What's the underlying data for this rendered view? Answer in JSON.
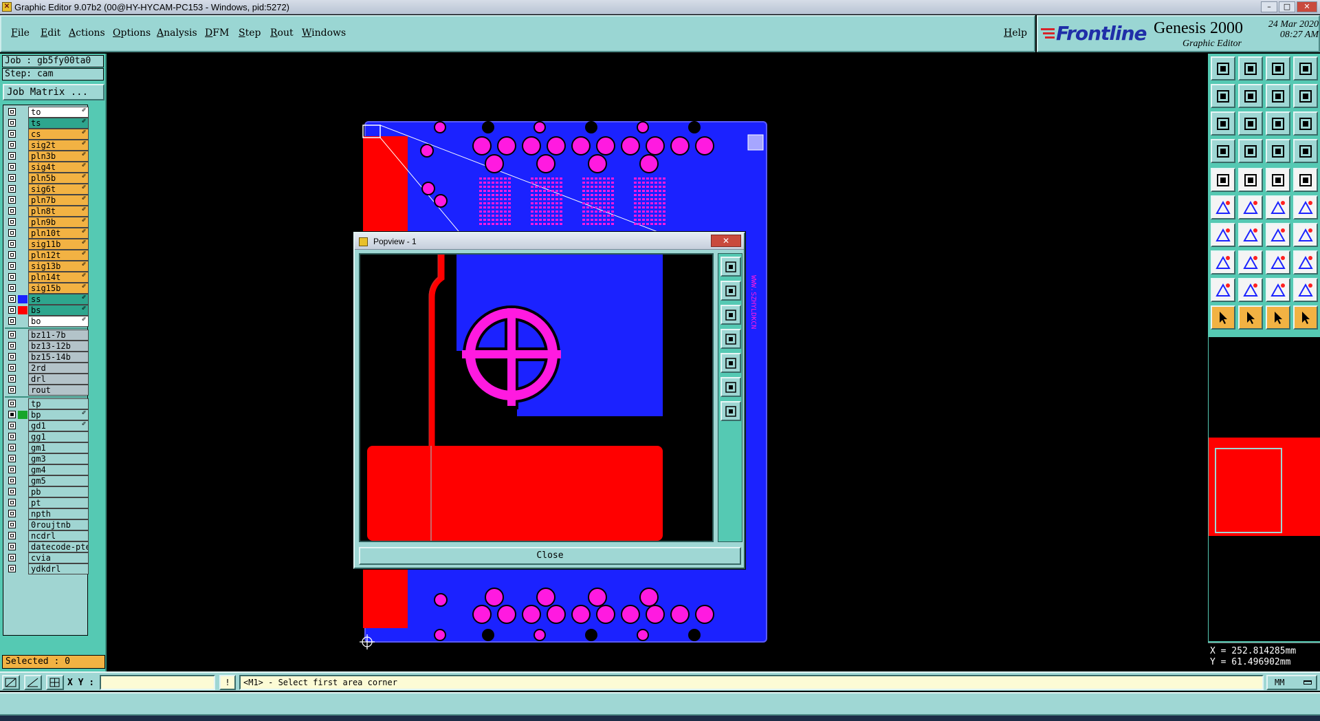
{
  "window": {
    "title": "Graphic Editor 9.07b2 (00@HY-HYCAM-PC153 - Windows, pid:5272)"
  },
  "menu": {
    "items": [
      "File",
      "Edit",
      "Actions",
      "Options",
      "Analysis",
      "DFM",
      "Step",
      "Rout",
      "Windows"
    ],
    "help": "Help"
  },
  "brand": {
    "logo": "Frontline",
    "product": "Genesis 2000",
    "subtitle": "Graphic Editor",
    "date": "24 Mar 2020",
    "time": "08:27 AM"
  },
  "job": {
    "job_line": "Job : gb5fy00ta0",
    "step_line": "Step: cam",
    "matrix_button": "Job Matrix ..."
  },
  "layers": {
    "board": [
      {
        "name": "to",
        "color": "#ffffff"
      },
      {
        "name": "ts",
        "color": "#2ea68e"
      },
      {
        "name": "cs",
        "color": "#f2b243"
      },
      {
        "name": "sig2t",
        "color": "#f2b243"
      },
      {
        "name": "pln3b",
        "color": "#f2b243"
      },
      {
        "name": "sig4t",
        "color": "#f2b243"
      },
      {
        "name": "pln5b",
        "color": "#f2b243"
      },
      {
        "name": "sig6t",
        "color": "#f2b243"
      },
      {
        "name": "pln7b",
        "color": "#f2b243"
      },
      {
        "name": "pln8t",
        "color": "#f2b243"
      },
      {
        "name": "pln9b",
        "color": "#f2b243"
      },
      {
        "name": "pln10t",
        "color": "#f2b243"
      },
      {
        "name": "sig11b",
        "color": "#f2b243"
      },
      {
        "name": "pln12t",
        "color": "#f2b243"
      },
      {
        "name": "sig13b",
        "color": "#f2b243"
      },
      {
        "name": "pln14t",
        "color": "#f2b243"
      },
      {
        "name": "sig15b",
        "color": "#f2b243"
      },
      {
        "name": "ss",
        "color": "#2ea68e",
        "swatch": "#1b22ff"
      },
      {
        "name": "bs",
        "color": "#2ea68e",
        "swatch": "#ff0000"
      },
      {
        "name": "bo",
        "color": "#ffffff"
      }
    ],
    "drill": [
      {
        "name": "bz11-7b"
      },
      {
        "name": "bz13-12b"
      },
      {
        "name": "bz15-14b"
      },
      {
        "name": "2rd"
      },
      {
        "name": "drl"
      },
      {
        "name": "rout"
      }
    ],
    "misc": [
      {
        "name": "tp"
      },
      {
        "name": "bp",
        "swatch": "#17a52a",
        "checked": true
      },
      {
        "name": "gd1"
      },
      {
        "name": "gg1"
      },
      {
        "name": "gm1"
      },
      {
        "name": "gm3"
      },
      {
        "name": "gm4"
      },
      {
        "name": "gm5"
      },
      {
        "name": "pb"
      },
      {
        "name": "pt"
      },
      {
        "name": "npth"
      },
      {
        "name": "0roujtnb"
      },
      {
        "name": "ncdrl"
      },
      {
        "name": "datecode-pte"
      },
      {
        "name": "cvia"
      },
      {
        "name": "ydkdrl"
      }
    ],
    "edit_glyph": "✐"
  },
  "status": {
    "selected": "Selected : 0"
  },
  "popview": {
    "title": "Popview - 1",
    "close_x": "✕",
    "close_button": "Close"
  },
  "coords": {
    "x": "X = 252.814285mm",
    "y": "Y = 61.496902mm"
  },
  "command": {
    "xy_label": "X Y :",
    "xy_value": "",
    "info_label": "!",
    "prompt": "<M1> - Select first area corner",
    "units": "MM"
  },
  "board": {
    "side_text": "WWW.SZHYLDKCN"
  },
  "colors": {
    "panel": "#55c9b3",
    "bar": "#9fd7d4",
    "copper": "#1b22ff",
    "pad": "#ff1ae0",
    "mask": "#ff0000"
  }
}
